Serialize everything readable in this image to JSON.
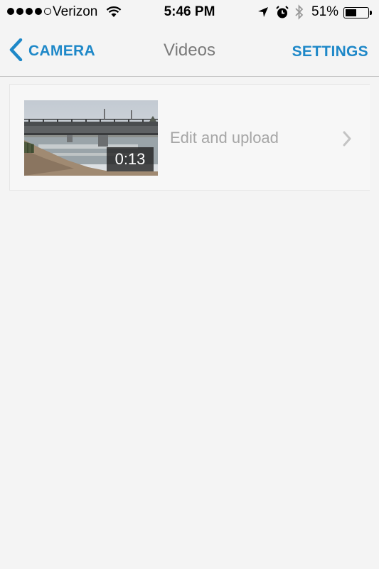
{
  "status_bar": {
    "carrier": "Verizon",
    "time": "5:46 PM",
    "battery_percent": "51%",
    "battery_level": 0.51,
    "signal_bars_filled": 4,
    "signal_bars_total": 5
  },
  "nav": {
    "back_label": "CAMERA",
    "title": "Videos",
    "settings_label": "SETTINGS",
    "accent_color": "#1e88c8"
  },
  "videos": [
    {
      "duration": "0:13",
      "action_label": "Edit and upload"
    }
  ]
}
